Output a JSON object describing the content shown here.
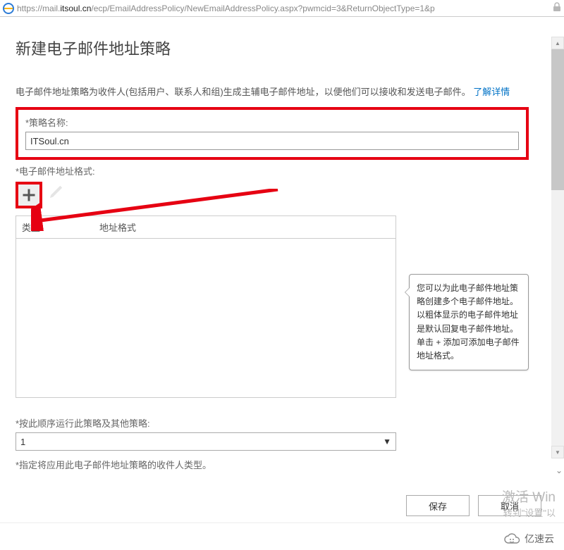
{
  "url": {
    "prefix": "https://mail.",
    "host": "itsoul.cn",
    "path": "/ecp/EmailAddressPolicy/NewEmailAddressPolicy.aspx?pwmcid=3&ReturnObjectType=1&p"
  },
  "page_title": "新建电子邮件地址策略",
  "description": {
    "text_a": "电子邮件地址策略为收件人(包括用户、联系人和组)生成主辅电子邮件地址，以便他们可以接收和发送电子邮件。",
    "link": "了解详情"
  },
  "fields": {
    "policy_name_label": "*策略名称:",
    "policy_name_value": "ITSoul.cn",
    "format_label": "*电子邮件地址格式:",
    "order_label": "*按此顺序运行此策略及其他策略:",
    "order_value": "1",
    "recipient_label": "*指定将应用此电子邮件地址策略的收件人类型。"
  },
  "table": {
    "col_type": "类型",
    "col_format": "地址格式"
  },
  "tooltip": "您可以为此电子邮件地址策略创建多个电子邮件地址。以粗体显示的电子邮件地址是默认回复电子邮件地址。单击 + 添加可添加电子邮件地址格式。",
  "buttons": {
    "save": "保存",
    "cancel": "取消"
  },
  "watermark": {
    "line1": "激活 Win",
    "line2": "转到\"设置\"以"
  },
  "brand": "亿速云"
}
